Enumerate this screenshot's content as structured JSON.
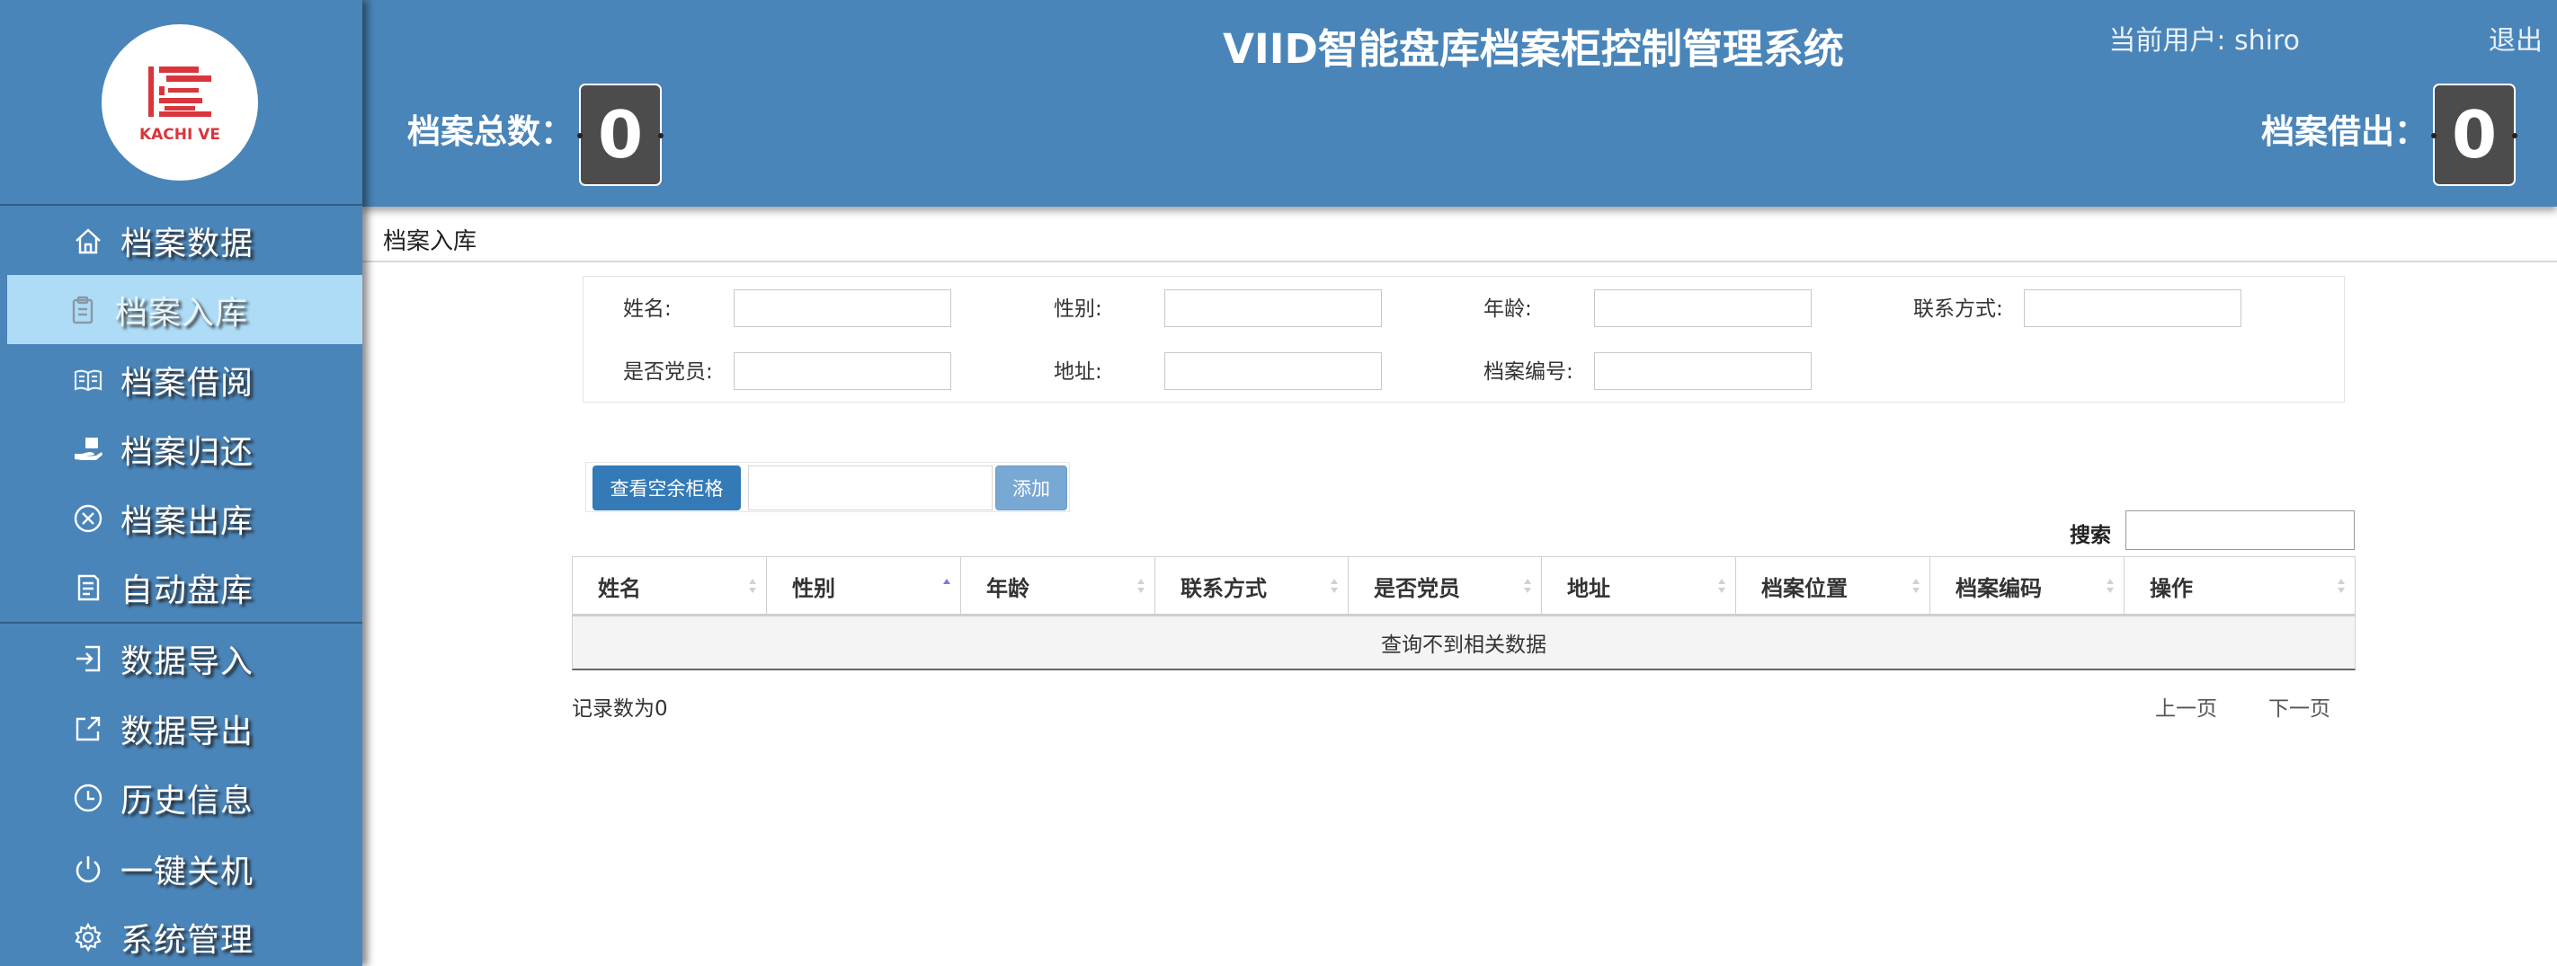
{
  "header": {
    "title": "VIID智能盘库档案柜控制管理系统",
    "current_user_label": "当前用户: shiro",
    "logout_label": "退出",
    "total_label": "档案总数：",
    "total_value": "0",
    "borrowed_label": "档案借出：",
    "borrowed_value": "0"
  },
  "logo": {
    "text": "KACHI VE",
    "icon": "kachive-logo"
  },
  "sidebar": {
    "items": [
      {
        "label": "档案数据",
        "icon": "home-icon",
        "active": false
      },
      {
        "label": "档案入库",
        "icon": "clipboard-icon",
        "active": true
      },
      {
        "label": "档案借阅",
        "icon": "open-book-icon",
        "active": false
      },
      {
        "label": "档案归还",
        "icon": "hand-return-icon",
        "active": false
      },
      {
        "label": "档案出库",
        "icon": "circle-x-icon",
        "active": false
      },
      {
        "label": "自动盘库",
        "icon": "edit-list-icon",
        "active": false
      },
      {
        "label": "数据导入",
        "icon": "import-icon",
        "active": false
      },
      {
        "label": "数据导出",
        "icon": "export-icon",
        "active": false
      },
      {
        "label": "历史信息",
        "icon": "clock-icon",
        "active": false
      },
      {
        "label": "一键关机",
        "icon": "power-icon",
        "active": false
      },
      {
        "label": "系统管理",
        "icon": "gear-icon",
        "active": false
      }
    ]
  },
  "breadcrumb": "档案入库",
  "form": {
    "name_label": "姓名:",
    "gender_label": "性别:",
    "age_label": "年龄:",
    "contact_label": "联系方式:",
    "party_label": "是否党员:",
    "address_label": "地址:",
    "archive_no_label": "档案编号:"
  },
  "toolbar": {
    "view_empty_label": "查看空余柜格",
    "add_label": "添加"
  },
  "search": {
    "label": "搜索"
  },
  "table": {
    "columns": [
      "姓名",
      "性别",
      "年龄",
      "联系方式",
      "是否党员",
      "地址",
      "档案位置",
      "档案编码",
      "操作"
    ],
    "sorted_column": "性别",
    "empty_text": "查询不到相关数据"
  },
  "footer": {
    "records_label": "记录数为0",
    "prev_label": "上一页",
    "next_label": "下一页"
  },
  "colors": {
    "primary": "#4a85b9",
    "active_menu": "#aedcf6",
    "button": "#347ab6",
    "button_light": "#78a8d4",
    "logo_red": "#d8363c"
  }
}
